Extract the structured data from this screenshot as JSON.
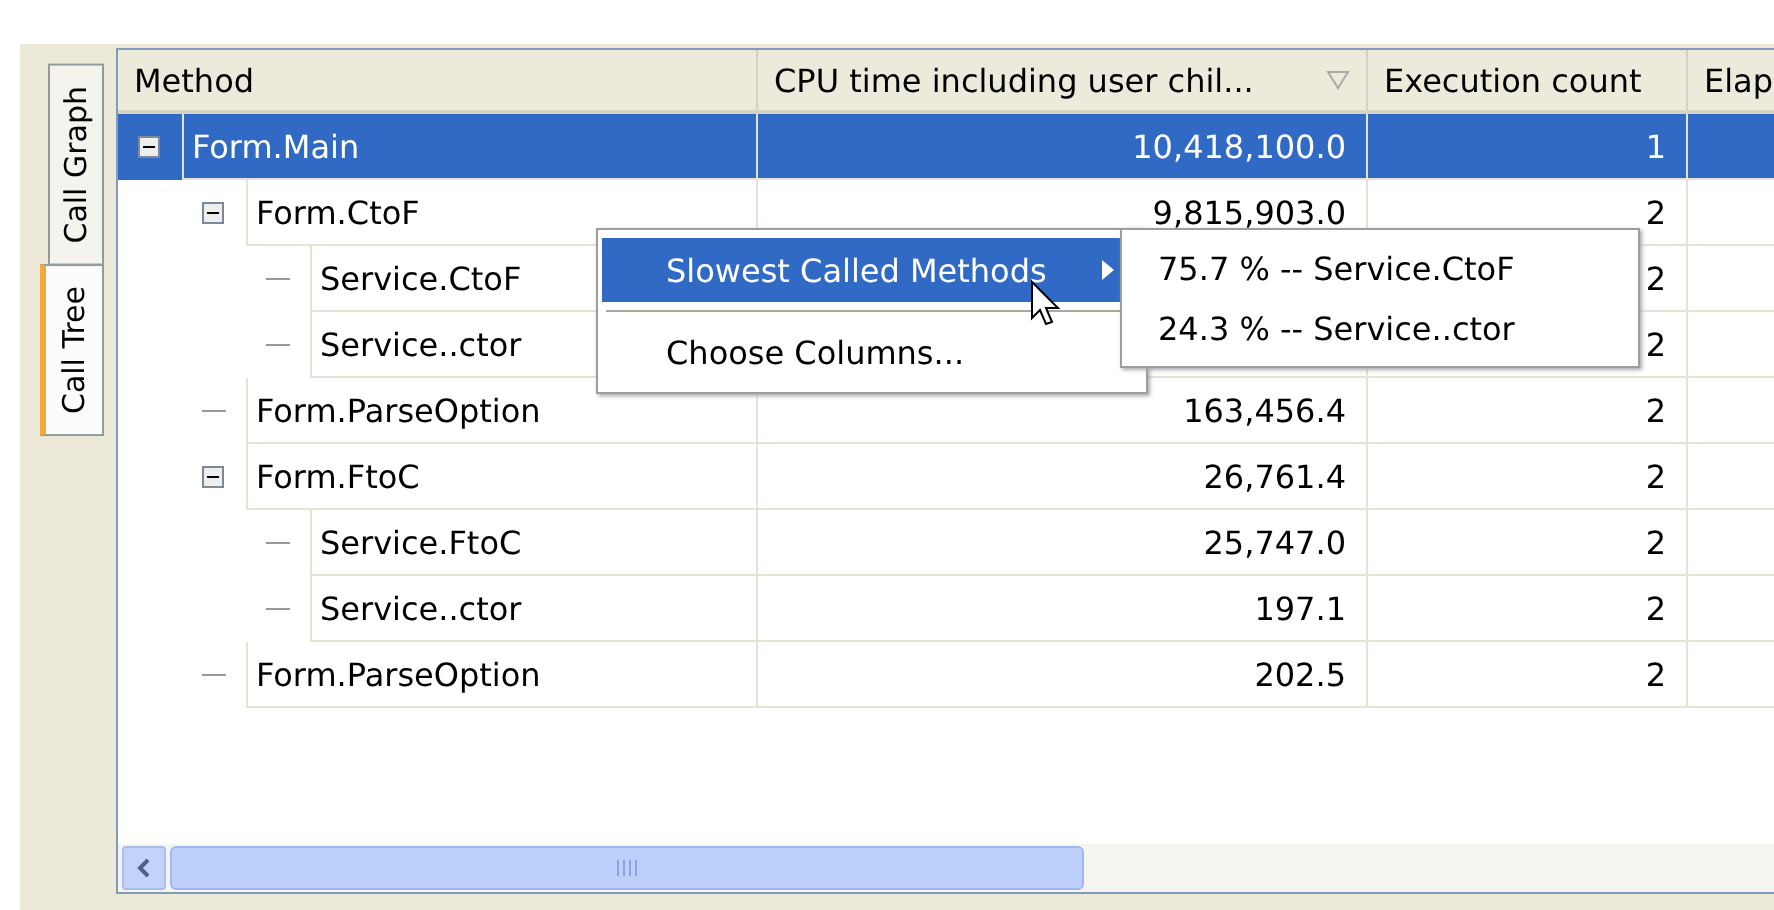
{
  "side_tabs": [
    {
      "label": "Call Graph",
      "selected": false
    },
    {
      "label": "Call Tree",
      "selected": true
    }
  ],
  "table": {
    "columns": [
      {
        "label": "Method",
        "sorted": false
      },
      {
        "label": "CPU time including user chil...",
        "sorted": true
      },
      {
        "label": "Execution count",
        "sorted": false
      },
      {
        "label": "Elap",
        "sorted": false
      }
    ],
    "rows": [
      {
        "method": "Form.Main",
        "cpu": "10,418,100.0",
        "count": "1",
        "selected": true,
        "expanded": true,
        "children": [
          {
            "method": "Form.CtoF",
            "cpu": "9,815,903.0",
            "count": "2",
            "selected": false,
            "expanded": true,
            "children": [
              {
                "method": "Service.CtoF",
                "count": "2",
                "selected": false
              },
              {
                "method": "Service..ctor",
                "count": "2",
                "selected": false
              }
            ]
          },
          {
            "method": "Form.ParseOption",
            "cpu": "163,456.4",
            "count": "2",
            "selected": false
          },
          {
            "method": "Form.FtoC",
            "cpu": "26,761.4",
            "count": "2",
            "selected": false,
            "expanded": true,
            "children": [
              {
                "method": "Service.FtoC",
                "cpu": "25,747.0",
                "count": "2",
                "selected": false
              },
              {
                "method": "Service..ctor",
                "cpu": "197.1",
                "count": "2",
                "selected": false
              }
            ]
          },
          {
            "method": "Form.ParseOption",
            "cpu": "202.5",
            "count": "2",
            "selected": false
          }
        ]
      }
    ]
  },
  "context_menu": {
    "items": [
      {
        "kind": "submenu",
        "label": "Slowest Called Methods",
        "selected": true
      },
      {
        "kind": "separator"
      },
      {
        "kind": "item",
        "label": "Choose Columns...",
        "selected": false
      }
    ],
    "submenu": [
      {
        "label": "75.7 % -- Service.CtoF"
      },
      {
        "label": "24.3 % -- Service..ctor"
      }
    ]
  }
}
